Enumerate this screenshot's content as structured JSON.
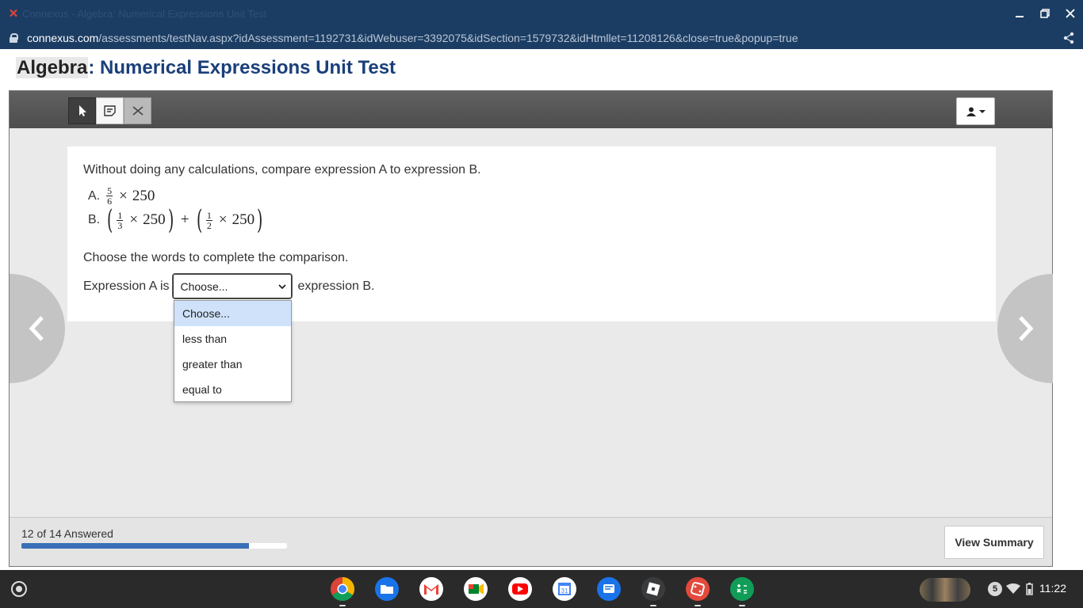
{
  "window": {
    "title": "Connexus - Algebra: Numerical Expressions Unit Test",
    "controls": [
      "minimize-icon",
      "restore-icon",
      "close-icon"
    ]
  },
  "address_bar": {
    "host": "connexus.com",
    "path": "/assessments/testNav.aspx?idAssessment=1192731&idWebuser=3392075&idSection=1579732&idHtmllet=11208126&close=true&popup=true"
  },
  "heading": {
    "subject": "Algebra",
    "separator": ":",
    "test_name": "Numerical Expressions Unit Test"
  },
  "toolbar": {
    "tools": [
      "pointer-tool",
      "note-tool",
      "eliminate-tool"
    ],
    "user_menu_icon": "user-icon"
  },
  "question": {
    "prompt": "Without doing any calculations, compare expression A to expression B.",
    "expression_a": {
      "label": "A.",
      "frac_num": "5",
      "frac_den": "6",
      "times": "×",
      "value": "250"
    },
    "expression_b": {
      "label": "B.",
      "left_paren": "(",
      "right_paren": ")",
      "frac1_num": "1",
      "frac1_den": "3",
      "frac2_num": "1",
      "frac2_den": "2",
      "times": "×",
      "plus": "+",
      "value": "250"
    },
    "instruction": "Choose the words to complete the comparison.",
    "answer_prefix": "Expression A is",
    "answer_suffix": "expression B.",
    "select_value": "Choose...",
    "options": [
      "Choose...",
      "less than",
      "greater than",
      "equal to"
    ],
    "highlighted_option": 0
  },
  "progress": {
    "label": "12 of 14 Answered",
    "answered": 12,
    "total": 14
  },
  "view_summary_label": "View Summary",
  "shelf": {
    "apps": [
      "chrome-icon",
      "files-icon",
      "gmail-icon",
      "meet-icon",
      "youtube-icon",
      "calendar-icon",
      "messages-icon",
      "roblox-icon",
      "dice-icon",
      "calculator-icon"
    ],
    "calendar_day": "31",
    "notification_count": "5",
    "time": "11:22"
  },
  "colors": {
    "chrome_blue": "#1c3d63",
    "heading_blue": "#1a3f7a",
    "progress_fill": "#3a6fb8",
    "option_highlight": "#cfe2fa"
  }
}
